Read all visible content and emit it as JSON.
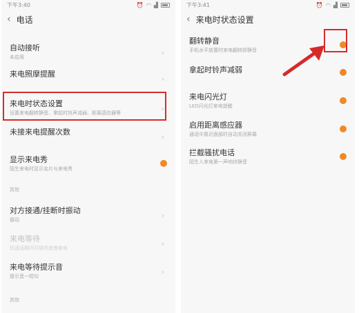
{
  "left": {
    "status_time": "下午3:40",
    "title": "电话",
    "items": [
      {
        "title": "自动接听",
        "subtitle": "未启用"
      },
      {
        "title": "来电照摩提醒",
        "subtitle": ""
      },
      {
        "title": "来电时状态设置",
        "subtitle": "设置来电翻转静音、拿起时铃声减弱、距离感应器等"
      },
      {
        "title": "未接来电提醒次数",
        "subtitle": ""
      },
      {
        "title": "显示来电秀",
        "subtitle": "陌生来电时显示名片与来电秀"
      }
    ],
    "section_label": "其他",
    "items2": [
      {
        "title": "对方接通/挂断时振动",
        "subtitle": "振动"
      },
      {
        "title": "来电等待",
        "subtitle": "仅通话期间可接听其他来电"
      },
      {
        "title": "来电等待提示音",
        "subtitle": "提示音一短句"
      }
    ],
    "footer_label": "其他"
  },
  "right": {
    "status_time": "下午3:41",
    "title": "来电时状态设置",
    "items": [
      {
        "title": "翻转静音",
        "subtitle": "手机水平放置时来电翻转即静音"
      },
      {
        "title": "拿起时铃声减弱",
        "subtitle": ""
      },
      {
        "title": "来电闪光灯",
        "subtitle": "LED闪光灯来电提醒"
      },
      {
        "title": "启用距离感应器",
        "subtitle": "通话中靠近面部时自动关闭屏幕"
      },
      {
        "title": "拦截骚扰电话",
        "subtitle": "陌生人来电第一声响铃静音"
      }
    ]
  },
  "colors": {
    "accent": "#f08a24",
    "highlight": "#d62a2a"
  },
  "icons": [
    "back-arrow-icon",
    "chevron-right-icon",
    "wifi-icon",
    "signal-icon",
    "battery-icon",
    "alarm-icon"
  ]
}
